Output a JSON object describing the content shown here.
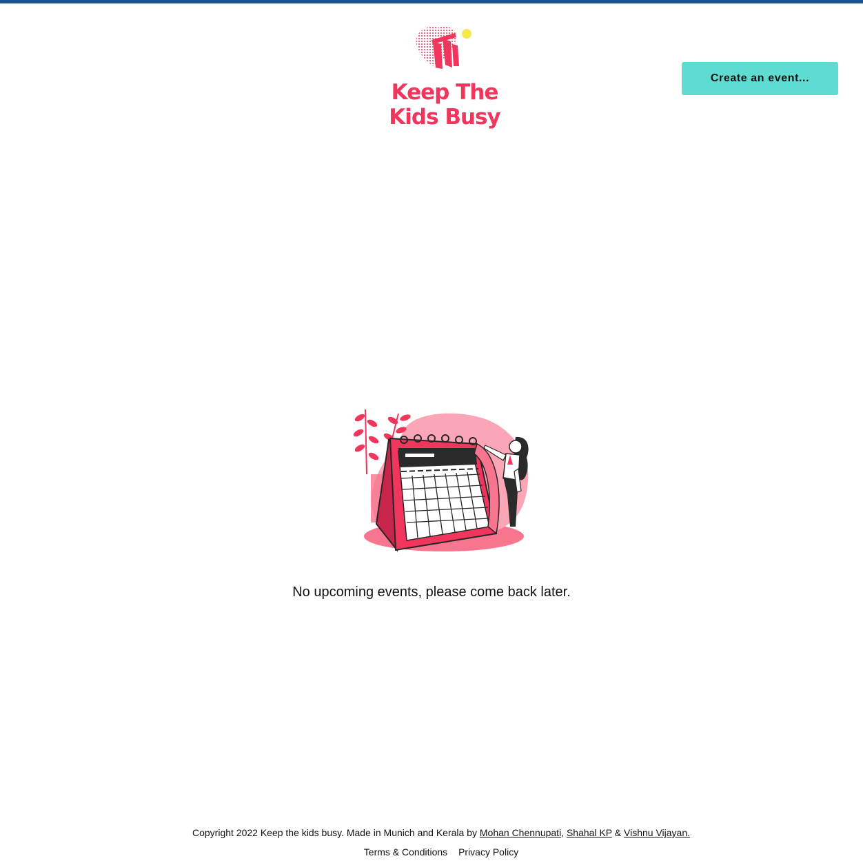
{
  "header": {
    "logo": {
      "line1": "Keep The",
      "line2": "Kids Busy"
    },
    "create_button_label": "Create an event..."
  },
  "main": {
    "empty_message": "No upcoming events, please come back later."
  },
  "footer": {
    "copyright_prefix": "Copyright 2022 Keep the kids busy. Made in Munich and Kerala by ",
    "authors": [
      "Mohan Chennupati",
      "Shahal KP",
      "Vishnu Vijayan."
    ],
    "separator_comma": ", ",
    "separator_amp": " & ",
    "links": [
      "Terms & Conditions",
      "Privacy Policy"
    ]
  },
  "colors": {
    "top_bar": "#17528f",
    "brand_pink": "#f0365c",
    "button_teal": "#5fdcd1",
    "accent_yellow": "#f5e94a"
  },
  "icons": {
    "logo_mark": "brush-stroke-logo-icon",
    "illustration": "calendar-woman-illustration"
  }
}
